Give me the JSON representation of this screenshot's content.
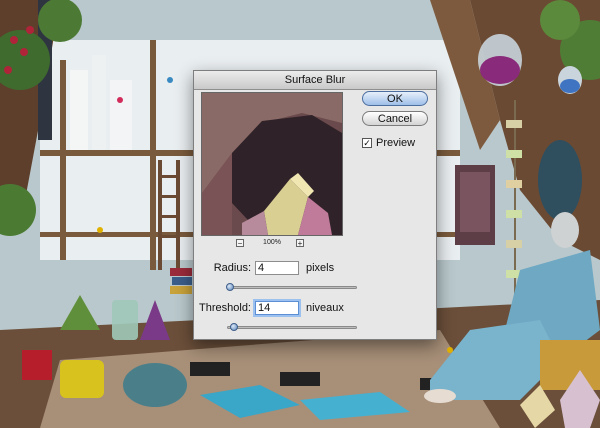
{
  "dialog": {
    "title": "Surface Blur",
    "ok_label": "OK",
    "cancel_label": "Cancel",
    "preview_label": "Preview",
    "preview_checked": true,
    "zoom_level": "100%",
    "zoom_out_label": "−",
    "zoom_in_label": "+"
  },
  "radius": {
    "label": "Radius:",
    "value": "4",
    "unit": "pixels",
    "slider_fraction": 0.02
  },
  "threshold": {
    "label": "Threshold:",
    "value": "14",
    "unit": "niveaux",
    "slider_fraction": 0.05
  },
  "colors": {
    "accent": "#5b8fd6",
    "dialog_bg": "#e7e7e7"
  }
}
